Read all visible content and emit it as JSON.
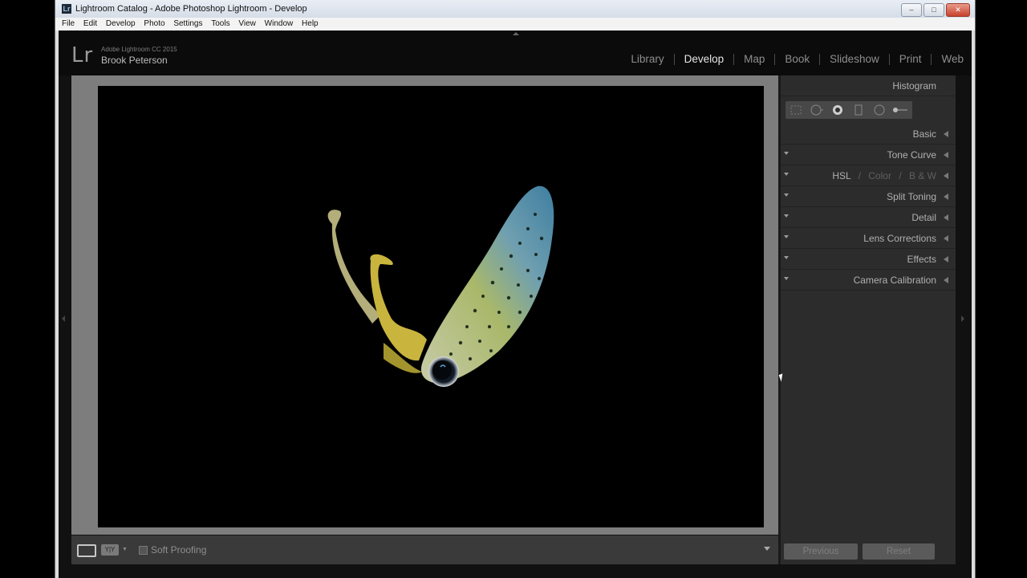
{
  "window": {
    "title": "Lightroom Catalog - Adobe Photoshop Lightroom - Develop"
  },
  "menu": [
    "File",
    "Edit",
    "Develop",
    "Photo",
    "Settings",
    "Tools",
    "View",
    "Window",
    "Help"
  ],
  "identity": {
    "logo": "Lr",
    "product": "Adobe Lightroom CC 2015",
    "user": "Brook Peterson"
  },
  "modules": [
    "Library",
    "Develop",
    "Map",
    "Book",
    "Slideshow",
    "Print",
    "Web"
  ],
  "active_module": "Develop",
  "toolbar": {
    "soft_proofing": "Soft Proofing"
  },
  "panels": {
    "histogram": "Histogram",
    "basic": "Basic",
    "tone_curve": "Tone Curve",
    "hsl": {
      "a": "HSL",
      "sep": "/",
      "b": "Color",
      "sep2": "/",
      "c": "B & W"
    },
    "split_toning": "Split Toning",
    "detail": "Detail",
    "lens_corrections": "Lens Corrections",
    "effects": "Effects",
    "camera_calibration": "Camera Calibration"
  },
  "buttons": {
    "previous": "Previous",
    "reset": "Reset"
  },
  "icons": [
    "crop-overlay-icon",
    "spot-removal-icon",
    "red-eye-icon",
    "graduated-filter-icon",
    "radial-filter-icon",
    "adjustment-brush-icon"
  ],
  "colors": {
    "chrome": "#111111",
    "panel": "#2c2c2c",
    "canvas": "#7d7d7d"
  }
}
